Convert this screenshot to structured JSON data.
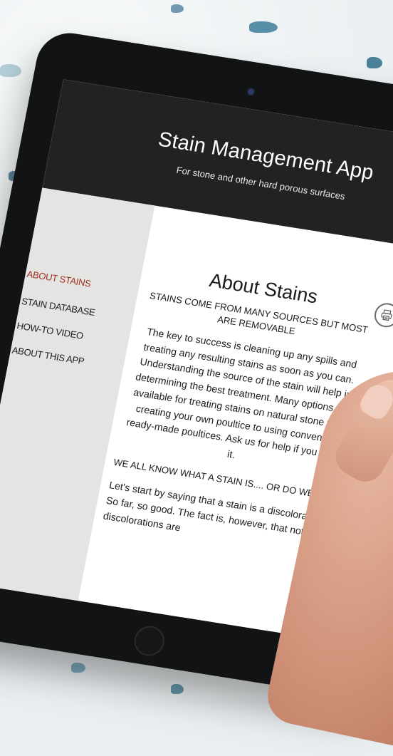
{
  "app": {
    "title": "Stain Management App",
    "subtitle": "For stone and other hard porous surfaces"
  },
  "sidebar": {
    "items": [
      {
        "label": "ABOUT STAINS",
        "active": true
      },
      {
        "label": "STAIN DATABASE",
        "active": false
      },
      {
        "label": "HOW-TO VIDEO",
        "active": false
      },
      {
        "label": "ABOUT THIS APP",
        "active": false
      }
    ]
  },
  "content": {
    "title": "About Stains",
    "print_icon": "printer-icon",
    "section1_heading": "STAINS COME FROM MANY SOURCES BUT MOST ARE REMOVABLE",
    "section1_text": "The key to success is cleaning up any spills and treating any resulting stains as soon as you can. Understanding the source of the stain will help in determining the best treatment. Many options are available for treating stains on natural stone from creating your own poultice to using convenient ready-made poultices. Ask us for help if you need it.",
    "section2_heading": "WE ALL KNOW WHAT A STAIN IS.... OR DO WE?",
    "section2_text": "Let's start by saying that a stain is a discoloration. So far, so good. The fact is, however, that not all discolorations are"
  },
  "colors": {
    "header_bg": "#202223",
    "sidebar_bg": "#e4e4e2",
    "active_nav": "#a4321f"
  }
}
